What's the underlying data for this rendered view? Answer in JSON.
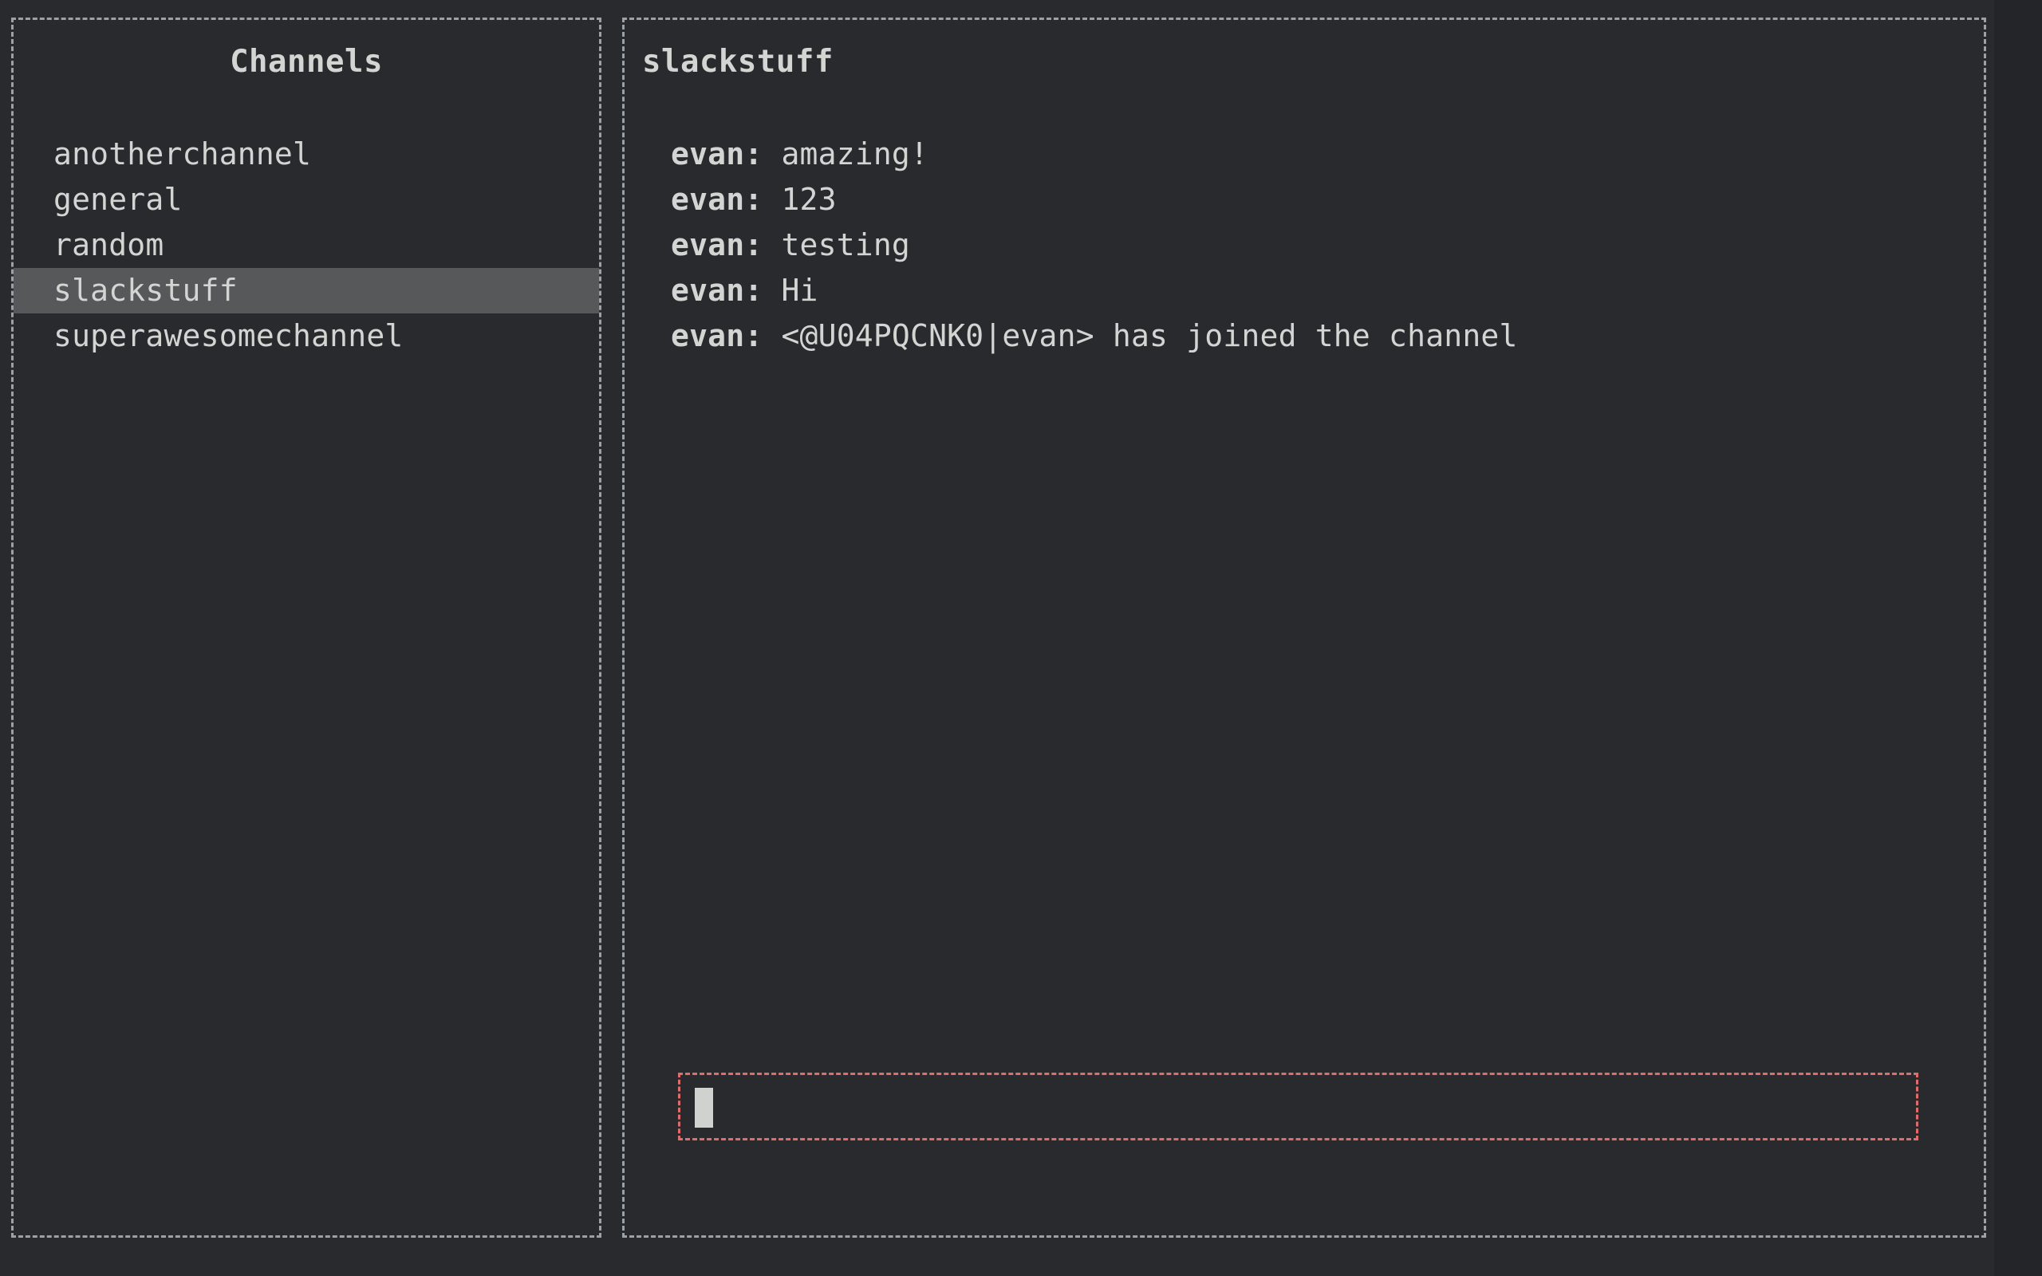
{
  "app": {
    "background_color": "#282a2e",
    "foreground_color": "#d3d5d3",
    "border_color": "#9ba1a6",
    "accent_color": "#e06c6c",
    "selection_color": "#56585a"
  },
  "sidebar": {
    "title": "Channels",
    "selected": "slackstuff",
    "items": [
      {
        "label": "anotherchannel",
        "selected": false
      },
      {
        "label": "general",
        "selected": false
      },
      {
        "label": "random",
        "selected": false
      },
      {
        "label": "slackstuff",
        "selected": true
      },
      {
        "label": "superawesomechannel",
        "selected": false
      }
    ]
  },
  "main": {
    "title": "slackstuff",
    "messages": [
      {
        "author": "evan:",
        "text": "amazing!"
      },
      {
        "author": "evan:",
        "text": "123"
      },
      {
        "author": "evan:",
        "text": "testing"
      },
      {
        "author": "evan:",
        "text": "Hi"
      },
      {
        "author": "evan:",
        "text": "<@U04PQCNK0|evan> has joined the channel"
      }
    ],
    "input": {
      "value": "",
      "cursor": "block"
    }
  }
}
